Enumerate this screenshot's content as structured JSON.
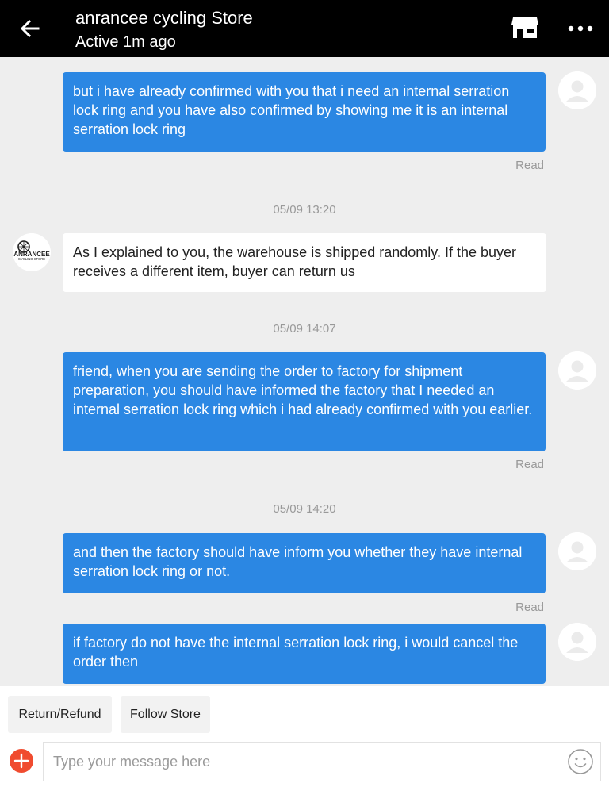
{
  "header": {
    "title": "anrancee cycling Store",
    "status": "Active 1m ago"
  },
  "store_avatar": {
    "brand": "ANRANCEE",
    "tagline": "CYCLING STORE"
  },
  "messages": [
    {
      "sender": "user",
      "text": "but i have already confirmed with you that i need an internal serration lock ring and you have also confirmed by showing me it is an internal serration lock ring",
      "read": "Read"
    },
    {
      "timestamp": "05/09 13:20"
    },
    {
      "sender": "store",
      "text": "As I explained to you, the warehouse is shipped randomly. If the buyer receives a different item, buyer can return us"
    },
    {
      "timestamp": "05/09 14:07"
    },
    {
      "sender": "user",
      "text": "friend, when you are sending the order to factory for shipment preparation, you should have informed the factory that I needed an internal serration lock ring which i had already confirmed with you earlier.",
      "read": "Read"
    },
    {
      "timestamp": "05/09 14:20"
    },
    {
      "sender": "user",
      "text": "and then the factory should have inform you whether they have internal serration lock ring or not.",
      "read": "Read"
    },
    {
      "sender": "user",
      "text": "if factory do not have the internal serration lock ring, i would cancel the order then"
    }
  ],
  "actions": {
    "refund": "Return/Refund",
    "follow": "Follow Store"
  },
  "composer": {
    "placeholder": "Type your message here",
    "value": ""
  },
  "colors": {
    "header_bg": "#000000",
    "outgoing_bubble": "#2b87e3",
    "incoming_bubble": "#ffffff",
    "plus_button": "#f04b2f"
  }
}
